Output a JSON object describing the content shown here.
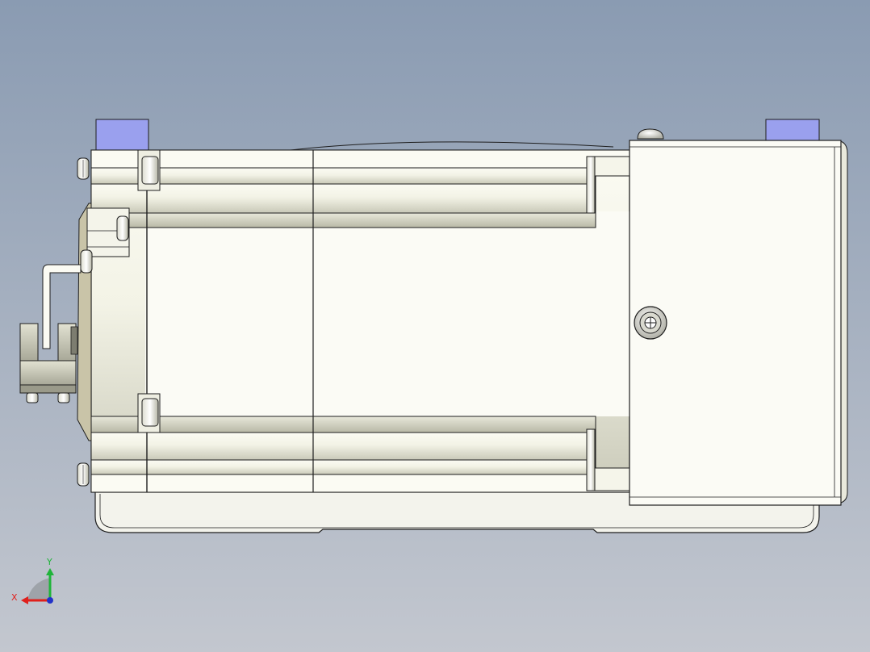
{
  "view": {
    "background_top": "#8a9bb2",
    "background_bottom": "#c3c7cf",
    "part_fill": "#f4f4ea",
    "edge_color": "#1e1e1e",
    "pad_color": "#9aa0ee"
  },
  "triad": {
    "x_label": "X",
    "y_label": "Y",
    "x_color": "#e0201c",
    "y_color": "#1fb43a",
    "z_color": "#2232c8"
  }
}
